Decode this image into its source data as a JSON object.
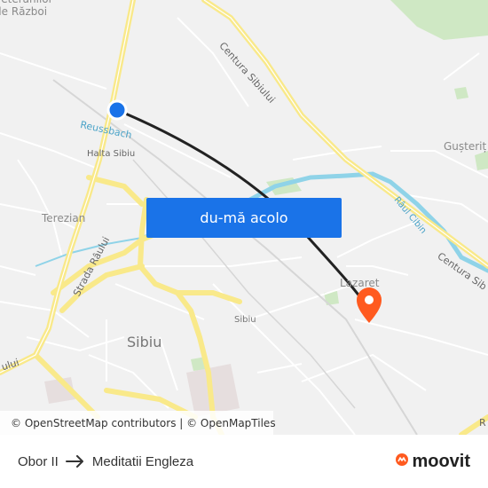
{
  "map": {
    "labels": {
      "veterans": "Veteranilor\nde Război",
      "ring_road_north": "Centura Sibiului",
      "ring_road_south": "Centura Sib",
      "reussbach": "Reussbach",
      "halta": "Halta Sibiu",
      "gusterita": "Gușteriț",
      "terezian": "Terezian",
      "strada_raului": "Strada Râului",
      "raul_cibin": "Râul Cibin",
      "lazaret": "Lazaret",
      "sibiu_station": "Sibiu",
      "sibiu_city": "Sibiu",
      "edge_left": "ului",
      "edge_right": "R"
    },
    "colors": {
      "background": "#f1f1f1",
      "major_road": "#f9e98a",
      "minor_road": "#ffffff",
      "river": "#8fd3e8",
      "park": "#cfe8c4",
      "route_line": "#222222",
      "origin_marker": "#1a73e8",
      "destination_marker": "#ff5a1f"
    }
  },
  "cta": {
    "label": "du-mă acolo"
  },
  "attribution": {
    "text": "© OpenStreetMap contributors | © OpenMapTiles"
  },
  "footer": {
    "origin": "Obor II",
    "destination": "Meditatii Engleza",
    "brand": "moovit"
  }
}
